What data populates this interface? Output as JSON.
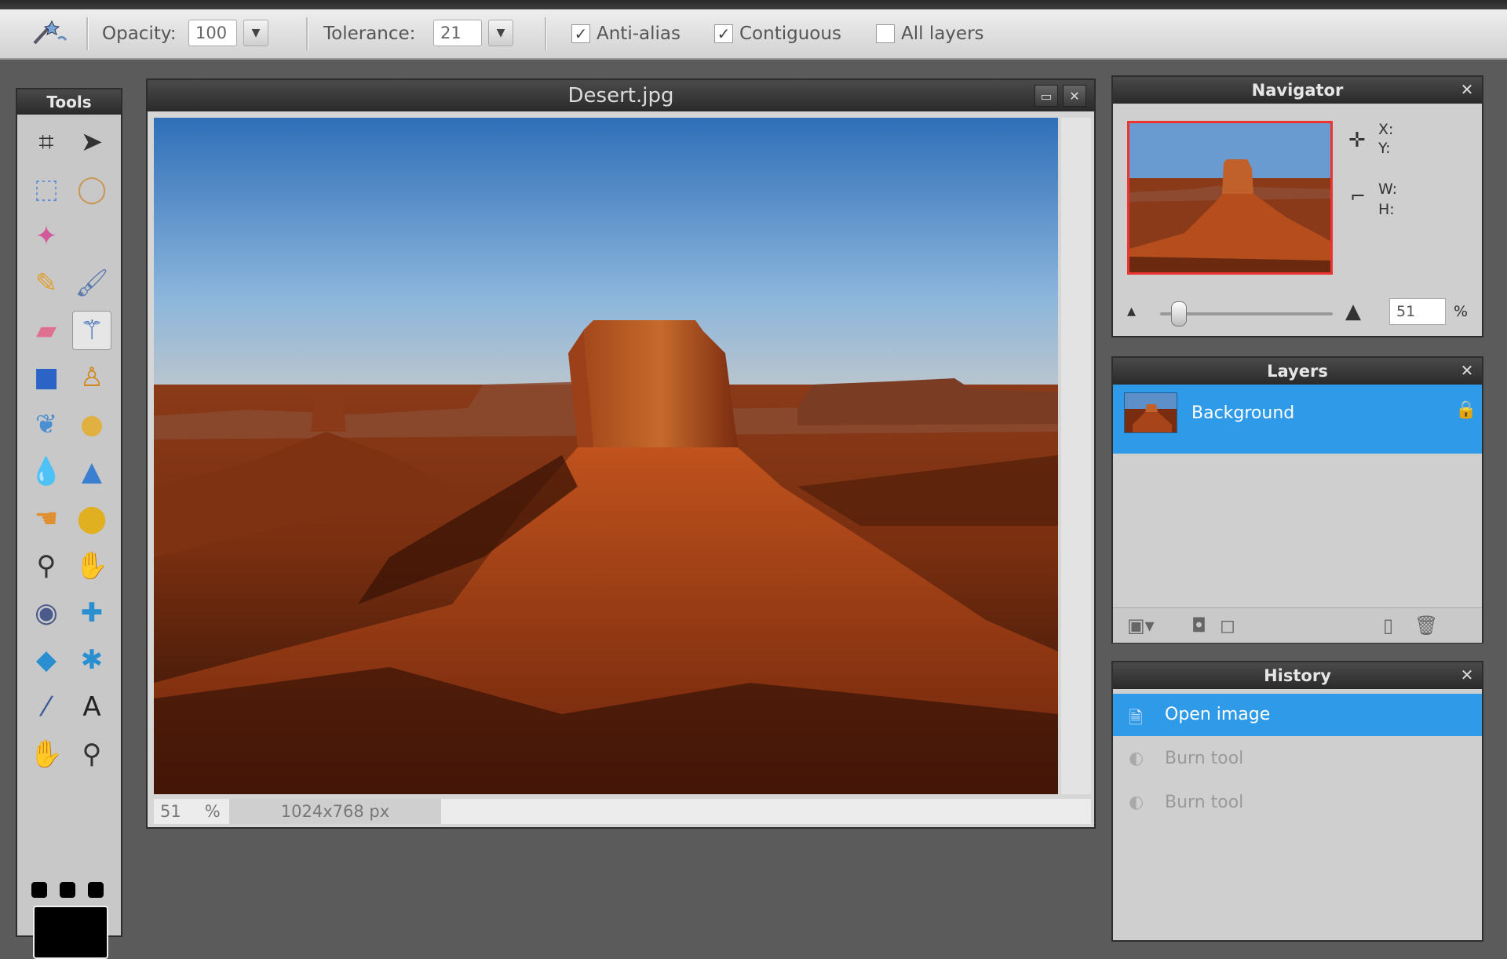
{
  "toolbar": {
    "tool_icon": "magic-wand-icon",
    "opacity_label": "Opacity:",
    "opacity_value": "100",
    "tolerance_label": "Tolerance:",
    "tolerance_value": "21",
    "anti_alias_label": "Anti-alias",
    "anti_alias_checked": true,
    "contiguous_label": "Contiguous",
    "contiguous_checked": true,
    "all_layers_label": "All layers",
    "all_layers_checked": false
  },
  "tools_panel": {
    "title": "Tools",
    "tools": [
      {
        "name": "crop-tool-icon",
        "glyph": "⌗"
      },
      {
        "name": "move-tool-icon",
        "glyph": "➤"
      },
      {
        "name": "marquee-tool-icon",
        "glyph": "⬚"
      },
      {
        "name": "lasso-tool-icon",
        "glyph": "◯"
      },
      {
        "name": "wand-tool-icon",
        "glyph": "✦"
      },
      {
        "name": "pencil-tool-icon",
        "glyph": "✎"
      },
      {
        "name": "brush-tool-icon",
        "glyph": "🖌"
      },
      {
        "name": "eraser-tool-icon",
        "glyph": "▰"
      },
      {
        "name": "magic-wand-tool-icon",
        "glyph": "⚚"
      },
      {
        "name": "gradient-tool-icon",
        "glyph": "■"
      },
      {
        "name": "stamp-tool-icon",
        "glyph": "♙"
      },
      {
        "name": "color-replace-tool-icon",
        "glyph": "❦"
      },
      {
        "name": "drawing-tool-icon",
        "glyph": "●"
      },
      {
        "name": "blur-tool-icon",
        "glyph": "💧"
      },
      {
        "name": "sharpen-tool-icon",
        "glyph": "▲"
      },
      {
        "name": "smudge-tool-icon",
        "glyph": "☚"
      },
      {
        "name": "sponge-tool-icon",
        "glyph": "⬤"
      },
      {
        "name": "dodge-tool-icon",
        "glyph": "⚲"
      },
      {
        "name": "burn-tool-icon",
        "glyph": "✋"
      },
      {
        "name": "red-eye-tool-icon",
        "glyph": "◉"
      },
      {
        "name": "spot-heal-tool-icon",
        "glyph": "✚"
      },
      {
        "name": "bloat-tool-icon",
        "glyph": "◆"
      },
      {
        "name": "pinch-tool-icon",
        "glyph": "✱"
      },
      {
        "name": "color-picker-tool-icon",
        "glyph": "⁄"
      },
      {
        "name": "type-tool-icon",
        "glyph": "A"
      },
      {
        "name": "hand-tool-icon",
        "glyph": "✋"
      },
      {
        "name": "zoom-tool-icon",
        "glyph": "⚲"
      }
    ],
    "fg_color": "#000000"
  },
  "document": {
    "title": "Desert.jpg",
    "zoom": "51",
    "zoom_unit": "%",
    "dimensions": "1024x768 px"
  },
  "navigator": {
    "title": "Navigator",
    "x_label": "X:",
    "y_label": "Y:",
    "w_label": "W:",
    "h_label": "H:",
    "zoom_value": "51",
    "zoom_unit": "%",
    "zoom_level": 0.51
  },
  "layers": {
    "title": "Layers",
    "items": [
      {
        "name": "Background",
        "locked": true
      }
    ]
  },
  "history": {
    "title": "History",
    "items": [
      {
        "label": "Open image",
        "selected": true
      },
      {
        "label": "Burn tool",
        "selected": false
      },
      {
        "label": "Burn tool",
        "selected": false
      }
    ]
  },
  "colors": {
    "selection_blue": "#2f9be8",
    "panel_header": "#2a2a2a",
    "navigator_frame": "#ee3333"
  }
}
